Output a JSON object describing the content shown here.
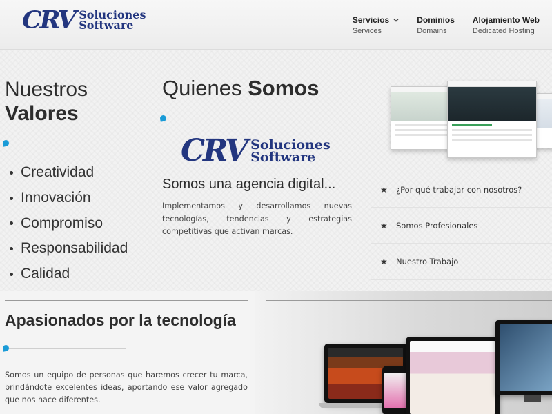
{
  "brand": {
    "mark": "CRV",
    "line1": "Soluciones",
    "line2": "Software",
    "color": "#23367f"
  },
  "nav": [
    {
      "title": "Servicios",
      "subtitle": "Services",
      "has_dropdown": true
    },
    {
      "title": "Dominios",
      "subtitle": "Domains",
      "has_dropdown": false
    },
    {
      "title": "Alojamiento Web",
      "subtitle": "Dedicated Hosting",
      "has_dropdown": false
    }
  ],
  "values": {
    "title_light": "Nuestros",
    "title_bold": "Valores",
    "items": [
      "Creatividad",
      "Innovación",
      "Compromiso",
      "Responsabilidad",
      "Calidad"
    ]
  },
  "about": {
    "title_light": "Quienes",
    "title_bold": "Somos",
    "agency": "Somos una agencia digital...",
    "description": "Implementamos y desarrollamos nuevas tecnologías, tendencias y estrategias competitivas que activan marcas."
  },
  "accordion": [
    {
      "label": "¿Por qué trabajar con nosotros?",
      "icon": "star-icon"
    },
    {
      "label": "Somos Profesionales",
      "icon": "star-icon"
    },
    {
      "label": "Nuestro Trabajo",
      "icon": "star-icon"
    }
  ],
  "passion": {
    "title": "Apasionados por la tecnología",
    "description": "Somos un equipo de personas que haremos crecer tu marca, brindándote excelentes ideas, aportando ese valor agregado que nos hace diferentes."
  },
  "colors": {
    "accent": "#1a9bd7",
    "text": "#333333"
  }
}
